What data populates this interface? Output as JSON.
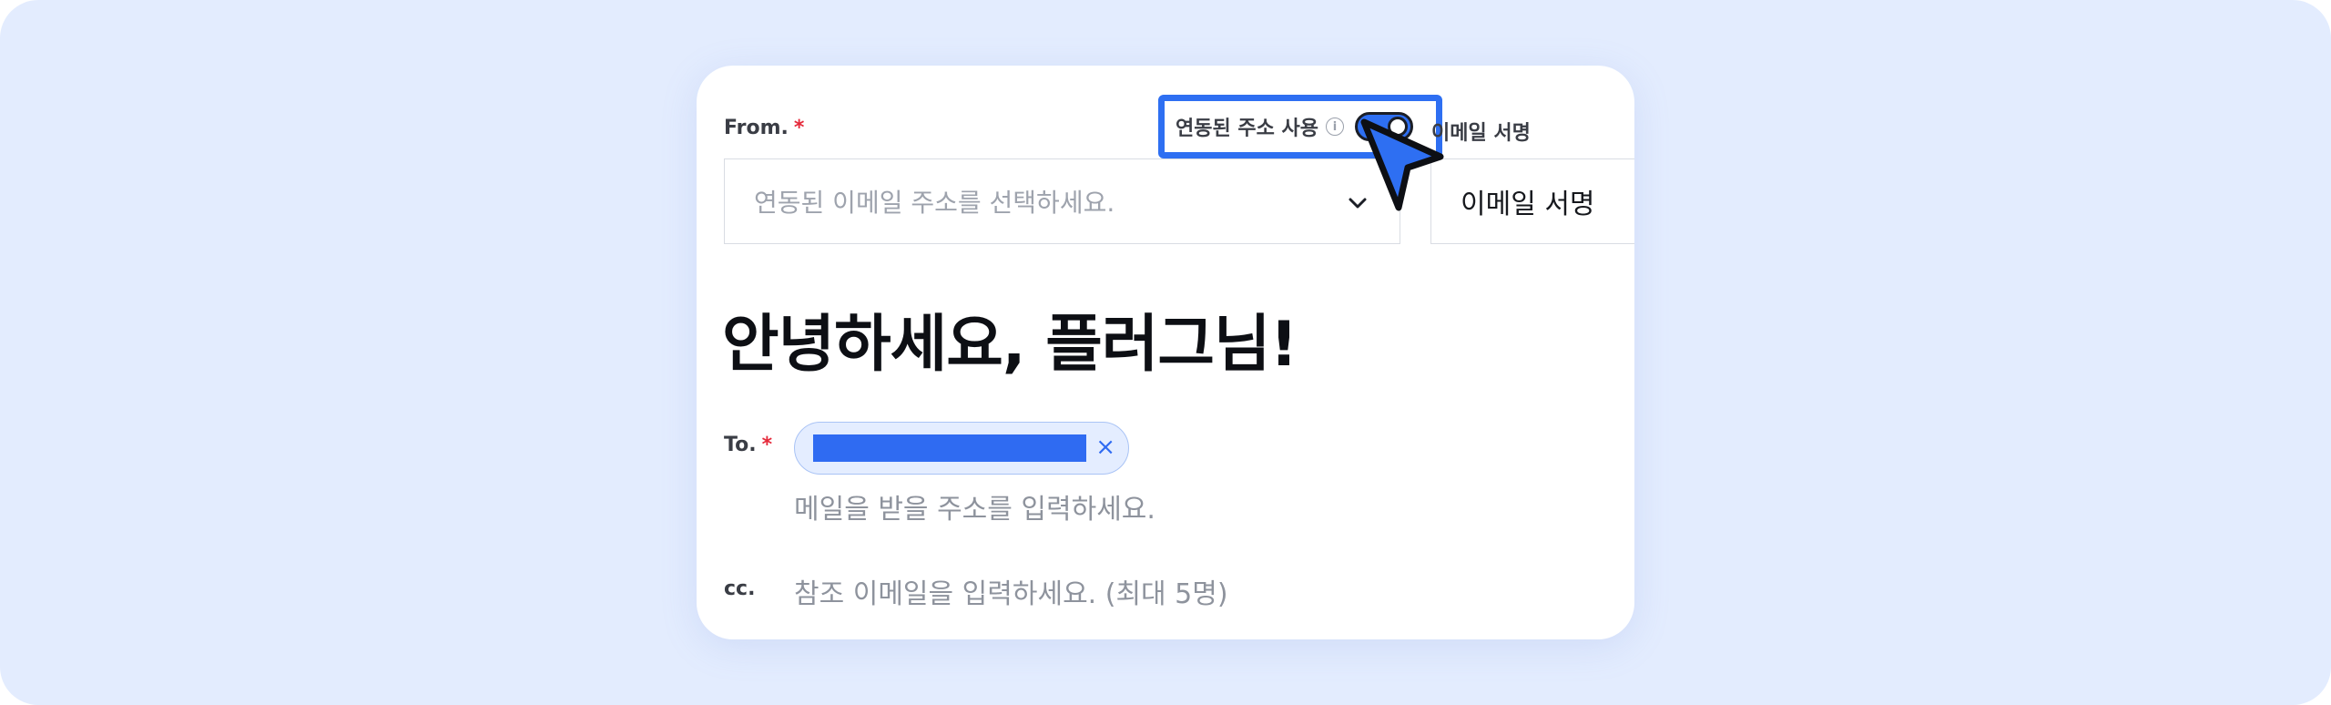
{
  "from": {
    "label": "From.",
    "required_mark": "*",
    "placeholder": "연동된 이메일 주소를 선택하세요."
  },
  "linked_toggle": {
    "label": "연동된 주소 사용",
    "info_glyph": "i",
    "state": "on"
  },
  "signature": {
    "label": "이메일 서명",
    "value": "이메일 서명"
  },
  "greeting": "안녕하세요, 플러그님!",
  "to": {
    "label": "To.",
    "required_mark": "*",
    "chip_close": "×",
    "placeholder": "메일을 받을 주소를 입력하세요."
  },
  "cc": {
    "label": "cc.",
    "placeholder": "참조 이메일을 입력하세요. (최대 5명)"
  },
  "colors": {
    "accent": "#2e6ff2",
    "background": "#e3ecfe",
    "required": "#e5293a"
  },
  "icons": [
    "info-icon",
    "chevron-down-icon",
    "close-icon",
    "cursor-pointer-icon"
  ]
}
